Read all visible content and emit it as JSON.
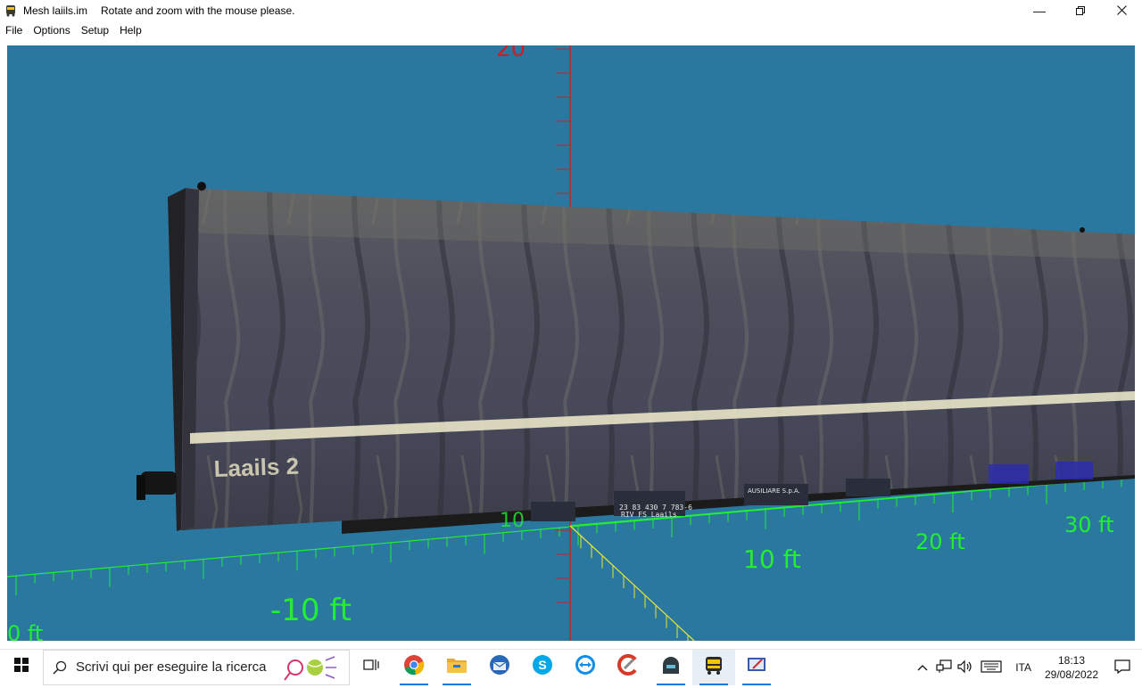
{
  "window": {
    "file_name": "Mesh laiils.im",
    "instruction": "Rotate and zoom with the mouse please.",
    "icon": "train-icon",
    "controls": [
      "minimize-icon",
      "restore-icon",
      "close-icon"
    ]
  },
  "menu": {
    "items": [
      "File",
      "Options",
      "Setup",
      "Help"
    ]
  },
  "viewport": {
    "background": "#2a77a0",
    "model_label": "Laails 2",
    "plate_text_1": "23 83 430 7 783-6",
    "plate_text_2": "RIV FS Laails",
    "plate_text_3": "AUSILIARE S.p.A.",
    "axis_labels": {
      "y_top": "20",
      "x_neg_10": "-10 ft",
      "x_10": "10 ft",
      "x_20": "20 ft",
      "x_30": "30 ft",
      "x_center": "10",
      "x_far_left": "0 ft"
    },
    "axis_colors": {
      "x": "#22ee33",
      "y": "#c8202a",
      "z": "#e8e830"
    }
  },
  "taskbar": {
    "search_placeholder": "Scrivi qui per eseguire la ricerca",
    "apps": [
      "task-view-icon",
      "chrome-icon",
      "file-explorer-icon",
      "thunderbird-icon",
      "skype-icon",
      "teamviewer-icon",
      "ccleaner-icon",
      "game-app-icon",
      "train-app-icon",
      "editor-app-icon"
    ],
    "language": "ITA",
    "time": "18:13",
    "date": "29/08/2022"
  }
}
